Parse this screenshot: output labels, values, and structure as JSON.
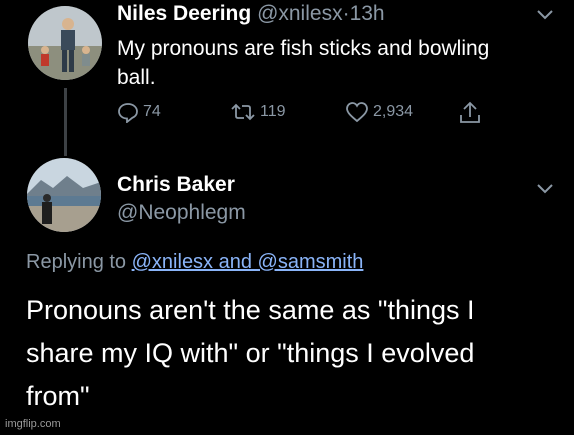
{
  "tweet1": {
    "display_name": "Niles Deering",
    "handle": "@xnilesx",
    "separator": "·",
    "time": "13h",
    "text_line1": "My pronouns are fish sticks and bowling",
    "text_line2": "ball.",
    "reply_count": "74",
    "retweet_count": "119",
    "like_count": "2,934"
  },
  "tweet2": {
    "display_name": "Chris Baker",
    "handle": "@Neophlegm",
    "replying_prefix": "Replying to",
    "replying_to": "@xnilesx and @samsmith",
    "text_line1": "Pronouns aren't the same as \"things I",
    "text_line2": "share my IQ with\" or \"things I evolved",
    "text_line3": "from\""
  },
  "watermark": "imgflip.com",
  "colors": {
    "background": "#000000",
    "text": "#ffffff",
    "muted": "#8b98a5",
    "mention": "#8ab4f8"
  },
  "icons": [
    "reply-icon",
    "retweet-icon",
    "like-icon",
    "share-icon",
    "chevron-down-icon"
  ]
}
